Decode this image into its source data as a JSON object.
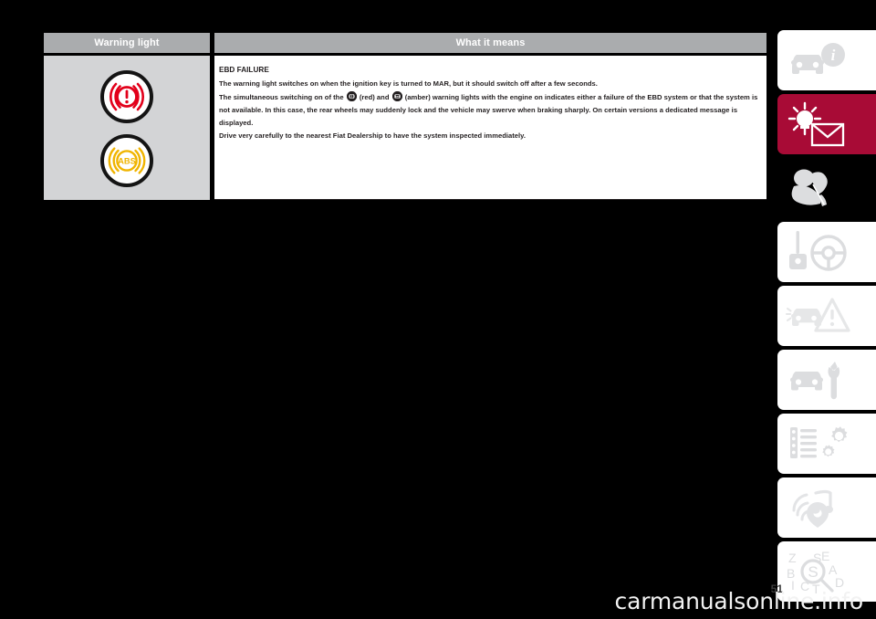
{
  "document": {
    "page_number": "51"
  },
  "table": {
    "headers": {
      "warning_light": "Warning light",
      "what_it_means": "What it means"
    },
    "warning_lights": [
      {
        "name": "brake-ebd-warning-lamp",
        "color": "#e2001a",
        "label": "!"
      },
      {
        "name": "abs-warning-lamp",
        "color": "#f0b400",
        "label": "ABS"
      }
    ],
    "content": {
      "title": "EBD FAILURE",
      "paragraph_1": "The warning light switches on when the ignition key is turned to MAR, but it should switch off after a few seconds.",
      "paragraph_2_part_1": "The simultaneous switching on of the ",
      "paragraph_2_icon_1_label": "(!)",
      "paragraph_2_part_2": " (red) and ",
      "paragraph_2_icon_2_label": "ABS",
      "paragraph_2_part_3": " (amber) warning lights with the engine on indicates either a failure of the EBD system or that the system is not available. In this case, the rear wheels may suddenly lock and the vehicle may swerve when braking sharply. On certain versions a dedicated message is displayed.",
      "paragraph_3": "Drive very carefully to the nearest Fiat Dealership to have the system inspected immediately."
    }
  },
  "sidebar": {
    "tabs": [
      {
        "id": "tab-dashboard-info",
        "icon": "car-info-icon",
        "style": "light"
      },
      {
        "id": "tab-warning-lights",
        "icon": "warning-lamp-mail-icon",
        "style": "accent"
      },
      {
        "id": "tab-safety",
        "icon": "child-seat-icon",
        "style": "dark"
      },
      {
        "id": "tab-starting-driving",
        "icon": "key-steering-icon",
        "style": "light"
      },
      {
        "id": "tab-emergency",
        "icon": "car-hazard-icon",
        "style": "light"
      },
      {
        "id": "tab-maintenance",
        "icon": "car-wrench-icon",
        "style": "light"
      },
      {
        "id": "tab-technical-specs",
        "icon": "list-gears-icon",
        "style": "light"
      },
      {
        "id": "tab-multimedia",
        "icon": "radio-music-icon",
        "style": "light"
      },
      {
        "id": "tab-index",
        "icon": "alphabet-search-icon",
        "style": "light"
      }
    ]
  },
  "watermark": {
    "text": "carmanualsonline.info"
  }
}
